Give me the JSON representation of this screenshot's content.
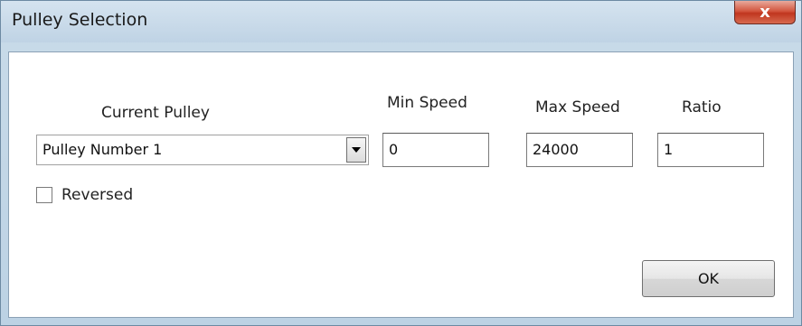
{
  "window": {
    "title": "Pulley Selection",
    "close_glyph": "x"
  },
  "form": {
    "current_pulley_label": "Current Pulley",
    "min_speed_label": "Min Speed",
    "max_speed_label": "Max Speed",
    "ratio_label": "Ratio",
    "current_pulley_value": "Pulley Number 1",
    "min_speed_value": "0",
    "max_speed_value": "24000",
    "ratio_value": "1",
    "reversed_label": "Reversed",
    "reversed_checked": false
  },
  "buttons": {
    "ok_label": "OK"
  },
  "icons": {
    "close": "close-icon",
    "dropdown": "chevron-down-icon"
  }
}
